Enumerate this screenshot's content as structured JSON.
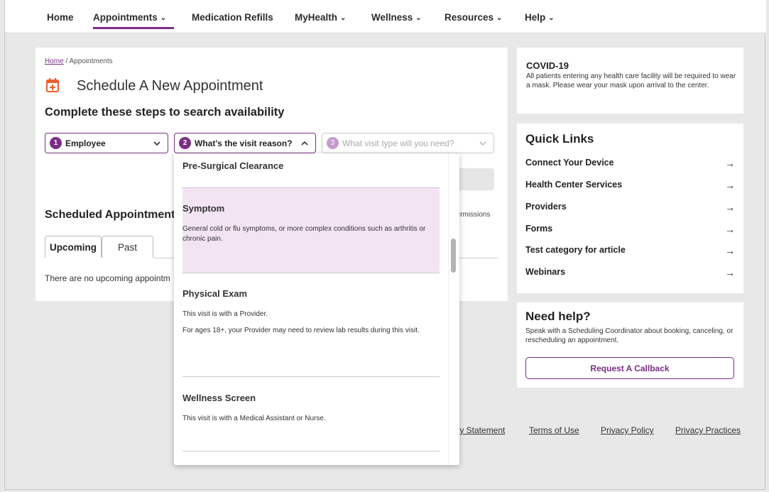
{
  "nav": {
    "items": [
      {
        "label": "Home",
        "dropdown": false
      },
      {
        "label": "Appointments",
        "dropdown": true,
        "active": true
      },
      {
        "label": "Medication Refills",
        "dropdown": false
      },
      {
        "label": "MyHealth",
        "dropdown": true
      },
      {
        "label": "Wellness",
        "dropdown": true
      },
      {
        "label": "Resources",
        "dropdown": true
      },
      {
        "label": "Help",
        "dropdown": true
      }
    ],
    "chevron": "⌄"
  },
  "breadcrumb": {
    "home": "Home",
    "separator": " / ",
    "current": "Appointments"
  },
  "page": {
    "title": "Schedule A New Appointment",
    "steps_heading": "Complete these steps to search availability",
    "steps": [
      {
        "number": "1",
        "label": "Employee",
        "state": "completed"
      },
      {
        "number": "2",
        "label": "What's the visit reason?",
        "state": "open"
      },
      {
        "number": "3",
        "label": "What visit type will you need?",
        "state": "disabled"
      }
    ],
    "scheduled_heading": "Scheduled Appointments",
    "permissions_text": "Permissions",
    "tabs": [
      {
        "label": "Upcoming",
        "active": true
      },
      {
        "label": "Past",
        "active": false
      }
    ],
    "no_appointments": "There are no upcoming appointm"
  },
  "dropdown": {
    "items": [
      {
        "title": "Pre-Surgical Clearance",
        "descriptions": []
      },
      {
        "title": "Symptom",
        "descriptions": [
          "General cold or flu symptoms, or more complex conditions such as arthritis or chronic pain."
        ],
        "highlighted": true
      },
      {
        "title": "Physical Exam",
        "descriptions": [
          "This visit is with a Provider.",
          "For ages 18+, your Provider may need to review lab results during this visit."
        ]
      },
      {
        "title": "Wellness Screen",
        "descriptions": [
          "This visit is with a Medical Assistant or Nurse."
        ]
      }
    ]
  },
  "covid": {
    "title": "COVID-19",
    "text": "All patients entering any health care facility will be required to wear a mask. Please wear your mask upon arrival to the center."
  },
  "quick_links": {
    "title": "Quick Links",
    "items": [
      "Connect Your Device",
      "Health Center Services",
      "Providers",
      "Forms",
      "Test category for article",
      "Webinars"
    ],
    "arrow": "→"
  },
  "help": {
    "title": "Need help?",
    "text": "Speak with a Scheduling Coordinator about booking, canceling, or rescheduling an appointment.",
    "button": "Request A Callback"
  },
  "footer": {
    "links": [
      "ty Statement",
      "Terms of Use",
      "Privacy Policy",
      "Privacy Practices"
    ]
  },
  "colors": {
    "accent": "#7a2d86",
    "highlight": "#f3e4f4",
    "icon_orange": "#e8612c"
  },
  "icons": {
    "calendar": "calendar-plus-icon",
    "chevron": "chevron-down-icon",
    "chevron_up": "chevron-up-icon",
    "arrow_right": "arrow-right-icon"
  }
}
